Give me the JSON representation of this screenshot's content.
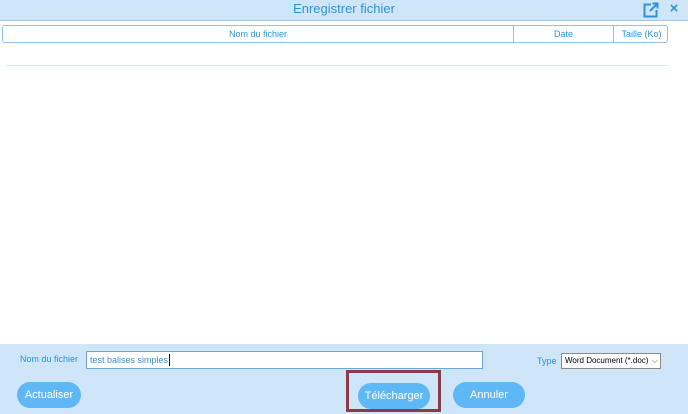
{
  "window": {
    "title": "Enregistrer  fichier"
  },
  "icons": {
    "popout": "popout-icon",
    "close": "close-icon",
    "close_glyph": "×"
  },
  "table": {
    "columns": [
      "Nom du fichier",
      "Date",
      "Taille (Ko)"
    ],
    "rows": []
  },
  "form": {
    "filename_label": "Nom du fichier",
    "filename_value": "test balises simples",
    "type_label": "Type",
    "type_value": "Word Document (*.doc)"
  },
  "buttons": {
    "refresh": "Actualiser",
    "download": "Télécharger",
    "cancel": "Annuler"
  },
  "colors": {
    "accent": "#2f92d6",
    "button": "#5fb8f6",
    "background": "#cfe6f8",
    "highlight": "#8b3a4a"
  }
}
